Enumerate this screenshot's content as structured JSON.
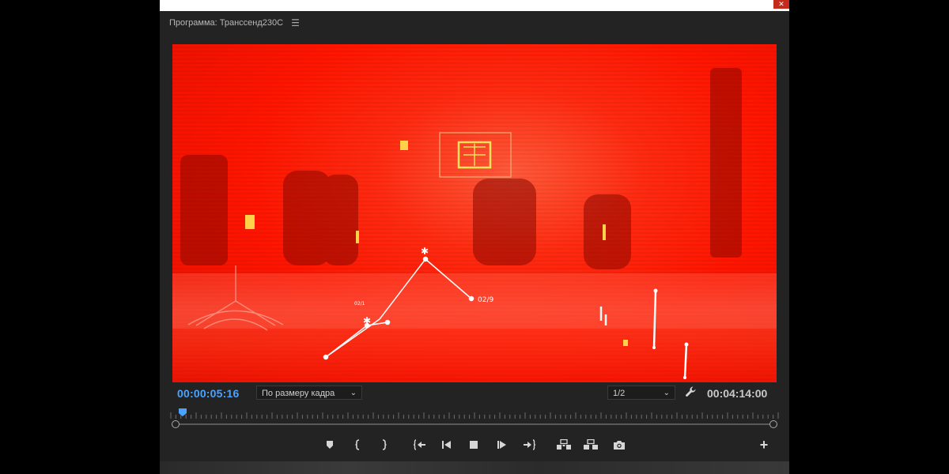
{
  "panel": {
    "title": "Программа: Транссенд230С",
    "menu_icon": "hamburger-menu-icon"
  },
  "window": {
    "close_glyph": "✕"
  },
  "monitor": {
    "current_timecode": "00:00:05:16",
    "fit_option": "По размеру кадра",
    "resolution": "1/2",
    "duration": "00:04:14:00"
  },
  "overlay_labels": {
    "tag1": "02/9",
    "tag2": "02/1"
  },
  "controls": [
    {
      "name": "add-marker-button",
      "icon": "marker-icon"
    },
    {
      "name": "mark-in-button",
      "icon": "mark-in-icon"
    },
    {
      "name": "mark-out-button",
      "icon": "mark-out-icon"
    },
    {
      "name": "go-to-in-button",
      "icon": "go-to-in-icon"
    },
    {
      "name": "step-back-button",
      "icon": "step-back-icon"
    },
    {
      "name": "stop-button",
      "icon": "stop-icon"
    },
    {
      "name": "step-forward-button",
      "icon": "step-forward-icon"
    },
    {
      "name": "go-to-out-button",
      "icon": "go-to-out-icon"
    },
    {
      "name": "lift-button",
      "icon": "lift-icon"
    },
    {
      "name": "extract-button",
      "icon": "extract-icon"
    },
    {
      "name": "export-frame-button",
      "icon": "camera-icon"
    }
  ],
  "add_button_label": "+",
  "colors": {
    "timecode_accent": "#4aa3ff",
    "panel_bg": "#232323",
    "video_tint": "#ff1500"
  }
}
